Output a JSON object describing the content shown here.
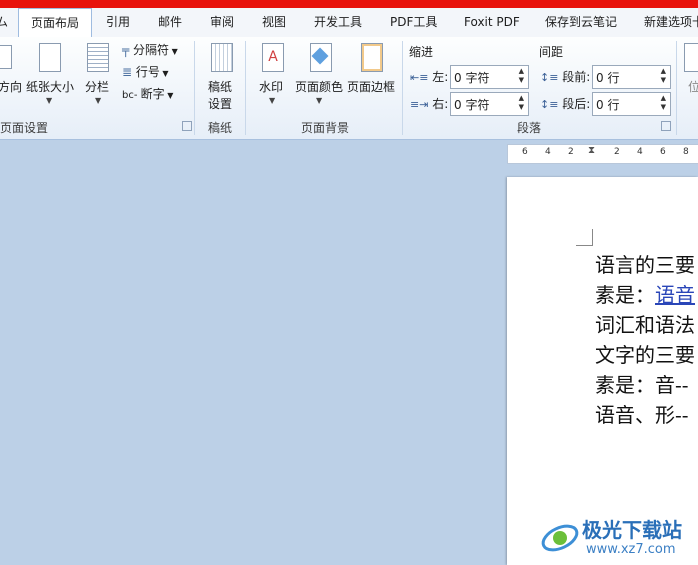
{
  "tabs": [
    "页面布局",
    "引用",
    "邮件",
    "审阅",
    "视图",
    "开发工具",
    "PDF工具",
    "Foxit PDF",
    "保存到云笔记",
    "新建选项卡"
  ],
  "active_tab": "页面布局",
  "ribbon": {
    "page_setup": {
      "label": "页面设置",
      "orientation": "方向",
      "paper_size": "纸张大小",
      "columns": "分栏",
      "breaks": "分隔符",
      "line_numbers": "行号",
      "hyphenation": "断字"
    },
    "draft_paper": {
      "label": "稿纸",
      "button_line1": "稿纸",
      "button_line2": "设置"
    },
    "page_background": {
      "label": "页面背景",
      "watermark": "水印",
      "page_color": "页面颜色",
      "page_borders": "页面边框"
    },
    "paragraph": {
      "label": "段落",
      "indent_title": "缩进",
      "left_label": "左:",
      "left_value": "0 字符",
      "right_label": "右:",
      "right_value": "0 字符",
      "spacing_title": "间距",
      "before_label": "段前:",
      "before_value": "0 行",
      "after_label": "段后:",
      "after_value": "0 行"
    },
    "arrange_partial": "位"
  },
  "ruler": [
    "6",
    "4",
    "2",
    "2",
    "4",
    "6",
    "8"
  ],
  "document": {
    "line1": "语言的三要",
    "line2_prefix": "素是：",
    "line2_link": "语音",
    "line3": "词汇和语法",
    "line4": "文字的三要",
    "line5": "素是：音--",
    "line6": "语音、形--"
  },
  "watermark": {
    "title": "极光下载站",
    "url": "www.xz7.com"
  },
  "colors": {
    "top_strip": "#e8120c",
    "background": "#bcd0e7",
    "link": "#2a46b8"
  }
}
